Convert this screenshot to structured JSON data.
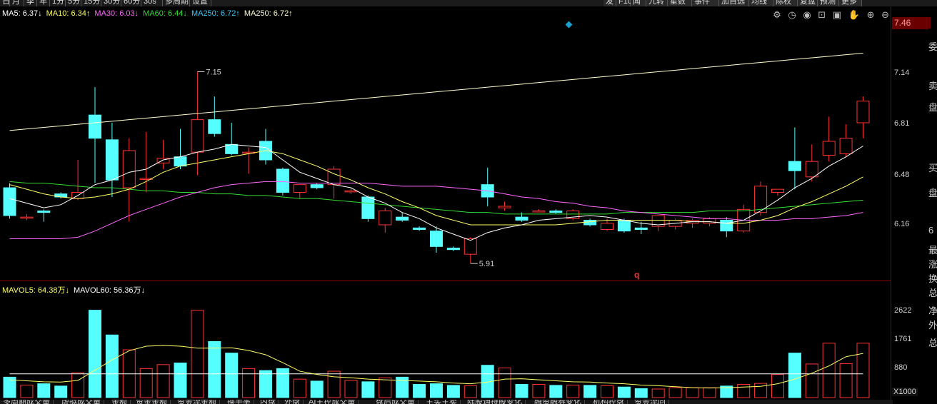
{
  "top_toolbar": {
    "left_items": [
      "日",
      "月",
      "季",
      "年",
      "1分",
      "5分",
      "15分",
      "30分",
      "60分",
      "30s",
      "多周期",
      "设置"
    ],
    "right_items": [
      "发",
      "F10",
      "闻",
      "九转",
      "星数",
      "事件",
      "加自选",
      "均线",
      "除权",
      "复盘",
      "预测",
      "更多"
    ]
  },
  "ma_legend": [
    {
      "label": "MA5:",
      "value": "6.37",
      "arrow": "↓",
      "color": "#ffffff"
    },
    {
      "label": "MA10:",
      "value": "6.34",
      "arrow": "↑",
      "color": "#ffff66"
    },
    {
      "label": "MA30:",
      "value": "6.03",
      "arrow": "↓",
      "color": "#ff66ff"
    },
    {
      "label": "MA60:",
      "value": "6.44",
      "arrow": "↓",
      "color": "#33dd33"
    },
    {
      "label": "MA250:",
      "value": "6.72",
      "arrow": "↑",
      "color": "#33ccff"
    },
    {
      "label": "MA250:",
      "value": "6.72",
      "arrow": "↑",
      "color": "#ffffcc"
    }
  ],
  "vol_legend": [
    {
      "label": "MAVOL5:",
      "value": "64.38万",
      "arrow": "↓",
      "color": "#ffff66"
    },
    {
      "label": "MAVOL60:",
      "value": "56.36万",
      "arrow": "↓",
      "color": "#ffffff"
    }
  ],
  "price_axis": {
    "current": "7.46",
    "ticks": [
      "7.14",
      "6.81",
      "6.48",
      "6.16"
    ]
  },
  "volume_axis": {
    "ticks": [
      "2622",
      "1761",
      "880"
    ],
    "unit": "X1000"
  },
  "annotations": {
    "high_label": "7.15",
    "low_label": "5.91",
    "q_marker": "q"
  },
  "sidebar_text": [
    "委",
    "卖",
    "盘",
    "买",
    "盘",
    "6",
    "最",
    "涨",
    "换",
    "总",
    "净",
    "外",
    "总"
  ],
  "bottom_tabs": [
    "多周期成交量",
    "虚拟成交量",
    "金额",
    "资金金额",
    "资金流金额",
    "换手率",
    "内盘",
    "外盘",
    "AI主控成交量",
    "盘后成交量",
    "主买主卖",
    "陆股通持股变化",
    "融资融券变化",
    "机构控盘",
    "资金流向"
  ],
  "toolbar_icons": [
    "settings-icon",
    "clock-icon",
    "eye-icon",
    "lock-icon",
    "bag-icon",
    "hand-icon",
    "zoom-in-icon",
    "zoom-out-icon"
  ],
  "colors": {
    "up": "#ff3333",
    "down": "#55ffff",
    "ma5": "#ffffff",
    "ma10": "#ffff66",
    "ma30": "#ff66ff",
    "ma60": "#33dd33",
    "ma250": "#ffffcc",
    "border": "#8a0000"
  },
  "chart_data": [
    {
      "type": "candlestick",
      "title": "",
      "y_axis": {
        "range": [
          5.8,
          7.48
        ],
        "ticks": [
          6.16,
          6.48,
          6.81,
          7.14
        ]
      },
      "candles": [
        {
          "o": 6.4,
          "h": 6.43,
          "l": 6.2,
          "c": 6.22
        },
        {
          "o": 6.21,
          "h": 6.23,
          "l": 6.19,
          "c": 6.21
        },
        {
          "o": 6.25,
          "h": 6.26,
          "l": 6.18,
          "c": 6.24
        },
        {
          "o": 6.36,
          "h": 6.37,
          "l": 6.33,
          "c": 6.34
        },
        {
          "o": 6.33,
          "h": 6.58,
          "l": 6.32,
          "c": 6.37
        },
        {
          "o": 6.87,
          "h": 7.05,
          "l": 6.43,
          "c": 6.72
        },
        {
          "o": 6.71,
          "h": 6.82,
          "l": 6.34,
          "c": 6.45
        },
        {
          "o": 6.4,
          "h": 6.72,
          "l": 6.18,
          "c": 6.64
        },
        {
          "o": 6.46,
          "h": 6.76,
          "l": 6.37,
          "c": 6.46
        },
        {
          "o": 6.56,
          "h": 6.71,
          "l": 6.52,
          "c": 6.59
        },
        {
          "o": 6.6,
          "h": 6.78,
          "l": 6.52,
          "c": 6.54
        },
        {
          "o": 6.63,
          "h": 7.15,
          "l": 6.48,
          "c": 6.84
        },
        {
          "o": 6.84,
          "h": 6.99,
          "l": 6.73,
          "c": 6.75
        },
        {
          "o": 6.68,
          "h": 6.82,
          "l": 6.61,
          "c": 6.62
        },
        {
          "o": 6.63,
          "h": 6.66,
          "l": 6.49,
          "c": 6.63
        },
        {
          "o": 6.7,
          "h": 6.78,
          "l": 6.55,
          "c": 6.58
        },
        {
          "o": 6.52,
          "h": 6.53,
          "l": 6.35,
          "c": 6.37
        },
        {
          "o": 6.37,
          "h": 6.42,
          "l": 6.33,
          "c": 6.42
        },
        {
          "o": 6.42,
          "h": 6.43,
          "l": 6.39,
          "c": 6.4
        },
        {
          "o": 6.42,
          "h": 6.54,
          "l": 6.33,
          "c": 6.52
        },
        {
          "o": 6.38,
          "h": 6.4,
          "l": 6.36,
          "c": 6.38
        },
        {
          "o": 6.34,
          "h": 6.35,
          "l": 6.18,
          "c": 6.2
        },
        {
          "o": 6.16,
          "h": 6.27,
          "l": 6.11,
          "c": 6.25
        },
        {
          "o": 6.21,
          "h": 6.24,
          "l": 6.18,
          "c": 6.19
        },
        {
          "o": 6.14,
          "h": 6.15,
          "l": 6.12,
          "c": 6.13
        },
        {
          "o": 6.12,
          "h": 6.15,
          "l": 5.98,
          "c": 6.02
        },
        {
          "o": 6.01,
          "h": 6.02,
          "l": 5.99,
          "c": 6.0
        },
        {
          "o": 5.97,
          "h": 6.08,
          "l": 5.91,
          "c": 6.07
        },
        {
          "o": 6.42,
          "h": 6.53,
          "l": 6.28,
          "c": 6.34
        },
        {
          "o": 6.27,
          "h": 6.31,
          "l": 6.25,
          "c": 6.28
        },
        {
          "o": 6.21,
          "h": 6.24,
          "l": 6.18,
          "c": 6.19
        },
        {
          "o": 6.25,
          "h": 6.26,
          "l": 6.24,
          "c": 6.25
        },
        {
          "o": 6.25,
          "h": 6.26,
          "l": 6.23,
          "c": 6.24
        },
        {
          "o": 6.2,
          "h": 6.26,
          "l": 6.19,
          "c": 6.25
        },
        {
          "o": 6.19,
          "h": 6.2,
          "l": 6.15,
          "c": 6.16
        },
        {
          "o": 6.13,
          "h": 6.2,
          "l": 6.12,
          "c": 6.17
        },
        {
          "o": 6.19,
          "h": 6.2,
          "l": 6.11,
          "c": 6.12
        },
        {
          "o": 6.14,
          "h": 6.18,
          "l": 6.1,
          "c": 6.13
        },
        {
          "o": 6.15,
          "h": 6.22,
          "l": 6.12,
          "c": 6.22
        },
        {
          "o": 6.15,
          "h": 6.2,
          "l": 6.13,
          "c": 6.19
        },
        {
          "o": 6.17,
          "h": 6.2,
          "l": 6.14,
          "c": 6.19
        },
        {
          "o": 6.17,
          "h": 6.21,
          "l": 6.15,
          "c": 6.2
        },
        {
          "o": 6.19,
          "h": 6.21,
          "l": 6.08,
          "c": 6.12
        },
        {
          "o": 6.12,
          "h": 6.29,
          "l": 6.11,
          "c": 6.26
        },
        {
          "o": 6.24,
          "h": 6.44,
          "l": 6.22,
          "c": 6.41
        },
        {
          "o": 6.37,
          "h": 6.39,
          "l": 6.35,
          "c": 6.39
        },
        {
          "o": 6.57,
          "h": 6.79,
          "l": 6.39,
          "c": 6.51
        },
        {
          "o": 6.47,
          "h": 6.68,
          "l": 6.44,
          "c": 6.57
        },
        {
          "o": 6.61,
          "h": 6.86,
          "l": 6.57,
          "c": 6.7
        },
        {
          "o": 6.62,
          "h": 6.81,
          "l": 6.6,
          "c": 6.72
        },
        {
          "o": 6.82,
          "h": 6.99,
          "l": 6.72,
          "c": 6.96
        }
      ],
      "ma5": [
        6.33,
        6.3,
        6.27,
        6.29,
        6.35,
        6.42,
        6.45,
        6.5,
        6.52,
        6.58,
        6.6,
        6.63,
        6.65,
        6.68,
        6.67,
        6.66,
        6.58,
        6.5,
        6.46,
        6.42,
        6.4,
        6.34,
        6.3,
        6.24,
        6.2,
        6.14,
        6.1,
        6.06,
        6.11,
        6.14,
        6.16,
        6.19,
        6.2,
        6.21,
        6.22,
        6.21,
        6.19,
        6.17,
        6.16,
        6.17,
        6.18,
        6.18,
        6.17,
        6.19,
        6.25,
        6.32,
        6.4,
        6.46,
        6.54,
        6.6,
        6.67
      ],
      "ma10": [
        6.42,
        6.39,
        6.36,
        6.34,
        6.33,
        6.34,
        6.36,
        6.39,
        6.44,
        6.5,
        6.54,
        6.56,
        6.58,
        6.6,
        6.62,
        6.64,
        6.62,
        6.58,
        6.54,
        6.49,
        6.45,
        6.4,
        6.36,
        6.31,
        6.27,
        6.22,
        6.19,
        6.16,
        6.16,
        6.16,
        6.16,
        6.16,
        6.16,
        6.17,
        6.18,
        6.19,
        6.19,
        6.19,
        6.19,
        6.19,
        6.18,
        6.18,
        6.17,
        6.17,
        6.19,
        6.22,
        6.27,
        6.31,
        6.36,
        6.41,
        6.47
      ],
      "ma30": [
        6.07,
        6.07,
        6.07,
        6.07,
        6.08,
        6.12,
        6.17,
        6.22,
        6.26,
        6.3,
        6.34,
        6.37,
        6.4,
        6.42,
        6.43,
        6.44,
        6.44,
        6.43,
        6.43,
        6.43,
        6.43,
        6.43,
        6.42,
        6.41,
        6.41,
        6.41,
        6.4,
        6.39,
        6.38,
        6.36,
        6.34,
        6.33,
        6.31,
        6.3,
        6.28,
        6.27,
        6.25,
        6.24,
        6.23,
        6.22,
        6.21,
        6.2,
        6.2,
        6.19,
        6.19,
        6.19,
        6.2,
        6.2,
        6.21,
        6.22,
        6.24
      ],
      "ma60": [
        6.44,
        6.43,
        6.43,
        6.42,
        6.41,
        6.4,
        6.4,
        6.39,
        6.38,
        6.38,
        6.37,
        6.37,
        6.36,
        6.36,
        6.35,
        6.35,
        6.34,
        6.33,
        6.33,
        6.32,
        6.31,
        6.3,
        6.29,
        6.28,
        6.27,
        6.26,
        6.25,
        6.24,
        6.24,
        6.23,
        6.23,
        6.23,
        6.23,
        6.23,
        6.23,
        6.23,
        6.24,
        6.24,
        6.24,
        6.24,
        6.24,
        6.25,
        6.25,
        6.25,
        6.26,
        6.27,
        6.28,
        6.29,
        6.3,
        6.31,
        6.32
      ],
      "ma250": [
        6.77,
        6.78,
        6.79,
        6.8,
        6.81,
        6.82,
        6.83,
        6.84,
        6.85,
        6.86,
        6.87,
        6.88,
        6.89,
        6.9,
        6.91,
        6.92,
        6.93,
        6.94,
        6.95,
        6.96,
        6.97,
        6.98,
        6.99,
        7.0,
        7.01,
        7.02,
        7.03,
        7.04,
        7.05,
        7.06,
        7.07,
        7.08,
        7.09,
        7.1,
        7.11,
        7.12,
        7.13,
        7.14,
        7.15,
        7.16,
        7.17,
        7.18,
        7.19,
        7.2,
        7.21,
        7.22,
        7.23,
        7.24,
        7.25,
        7.26,
        7.27
      ]
    },
    {
      "type": "bar",
      "title": "",
      "y_axis": {
        "range": [
          0,
          3400
        ],
        "ticks": [
          880,
          1761,
          2622
        ],
        "unit": "X1000"
      },
      "volumes": [
        620,
        380,
        420,
        350,
        750,
        2650,
        1900,
        1450,
        880,
        1000,
        1050,
        2650,
        1700,
        1350,
        880,
        820,
        880,
        560,
        500,
        800,
        520,
        480,
        600,
        620,
        400,
        420,
        370,
        360,
        980,
        900,
        400,
        400,
        370,
        380,
        370,
        360,
        320,
        270,
        260,
        300,
        300,
        300,
        350,
        400,
        430,
        700,
        1350,
        1020,
        1650,
        1030,
        1650
      ],
      "ma_vol5": [
        540,
        510,
        480,
        470,
        520,
        830,
        1140,
        1420,
        1560,
        1580,
        1560,
        1500,
        1500,
        1510,
        1430,
        1300,
        1060,
        800,
        700,
        630,
        600,
        560,
        540,
        520,
        500,
        480,
        440,
        420,
        470,
        560,
        570,
        540,
        510,
        480,
        470,
        440,
        420,
        380,
        360,
        330,
        300,
        290,
        300,
        320,
        340,
        420,
        560,
        740,
        960,
        1240,
        1340
      ],
      "ma_vol60": [
        720,
        720,
        720,
        720,
        720,
        720,
        720,
        720,
        720,
        720,
        720,
        720,
        720,
        720,
        720,
        720,
        720,
        720,
        720,
        720,
        720,
        720,
        720,
        720,
        720,
        720,
        720,
        720,
        720,
        720,
        720,
        720,
        720,
        720,
        720,
        720,
        720,
        720,
        720,
        720,
        720,
        720,
        720,
        720,
        720,
        720,
        720,
        720,
        720,
        720,
        720
      ]
    }
  ]
}
